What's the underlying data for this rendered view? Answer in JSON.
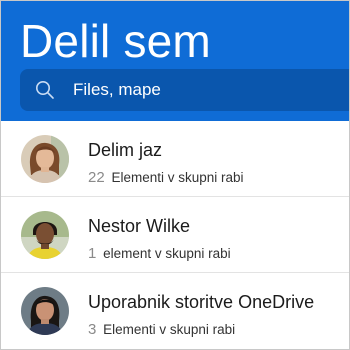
{
  "header": {
    "title": "Delil sem"
  },
  "search": {
    "placeholder": "Files, mape",
    "icon": "search-icon"
  },
  "people": [
    {
      "name": "Delim jaz",
      "count": "22",
      "label": "Elementi v skupni rabi"
    },
    {
      "name": "Nestor Wilke",
      "count": "1",
      "label": "element v skupni rabi"
    },
    {
      "name": "Uporabnik storitve OneDrive",
      "count": "3",
      "label": "Elementi v skupni rabi"
    }
  ],
  "colors": {
    "header": "#0f6cd6",
    "search_bg": "#0a56ad",
    "divider": "#e3e3e3"
  }
}
